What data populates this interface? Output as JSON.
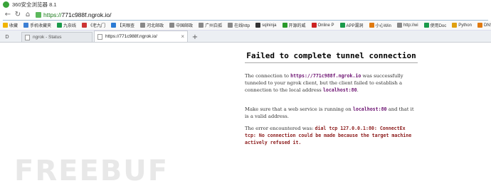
{
  "window": {
    "title": "360安全浏览器 8.1"
  },
  "address": {
    "scheme": "https://",
    "host": "771c988f.ngrok.io",
    "path": "/"
  },
  "bookmarks": [
    {
      "label": "收藏",
      "icon": "star-icon",
      "color": "#f0b400"
    },
    {
      "label": "手机收藏夹",
      "icon": "phone-icon",
      "color": "#3b7fd4"
    },
    {
      "label": "九奈线",
      "icon": "site-icon",
      "color": "#1a9a4a"
    },
    {
      "label": "《老九门",
      "icon": "site-icon",
      "color": "#c33"
    },
    {
      "label": "【天眼查",
      "icon": "site-icon",
      "color": "#2a7ad4"
    },
    {
      "label": "河北邮政",
      "icon": "page-icon",
      "color": "#888"
    },
    {
      "label": "中国邮政",
      "icon": "page-icon",
      "color": "#888"
    },
    {
      "label": "广州白孤",
      "icon": "page-icon",
      "color": "#888"
    },
    {
      "label": "在线http",
      "icon": "page-icon",
      "color": "#888"
    },
    {
      "label": "sqlninja",
      "icon": "site-icon",
      "color": "#333"
    },
    {
      "label": "开源的威",
      "icon": "site-icon",
      "color": "#2a9a2a"
    },
    {
      "label": "Online P",
      "icon": "site-icon",
      "color": "#c22"
    },
    {
      "label": "APP漏洞",
      "icon": "site-icon",
      "color": "#1a9a4a"
    },
    {
      "label": "小心Win",
      "icon": "site-icon",
      "color": "#e07a10"
    },
    {
      "label": "http://wi",
      "icon": "page-icon",
      "color": "#888"
    },
    {
      "label": "使用Doc",
      "icon": "site-icon",
      "color": "#1a9a4a"
    },
    {
      "label": "Python",
      "icon": "site-icon",
      "color": "#e0a010"
    },
    {
      "label": "DNS Sh",
      "icon": "site-icon",
      "color": "#e07a10"
    }
  ],
  "tabs": [
    {
      "label": "ngrok - Status",
      "active": false
    },
    {
      "label": "https://771c988f.ngrok.io/",
      "active": true,
      "close": "×"
    }
  ],
  "sidebar_toggle": "D",
  "new_tab": "+",
  "page": {
    "heading": "Failed to complete tunnel connection",
    "p1_a": "The connection to ",
    "p1_url": "https://771c988f.ngrok.io",
    "p1_b": " was successfully tunneled to your ngrok client, but the client failed to establish a connection to the local address ",
    "p1_addr": "localhost:80",
    "p1_c": ".",
    "p2_a": "Make sure that a web service is running on ",
    "p2_addr": "localhost:80",
    "p2_b": " and that it is a valid address.",
    "p3_a": "The error encountered was: ",
    "p3_err": "dial tcp 127.0.0.1:80: ConnectEx tcp: No connection could be made because the target machine actively refused it."
  },
  "watermark": "FREEBUF"
}
